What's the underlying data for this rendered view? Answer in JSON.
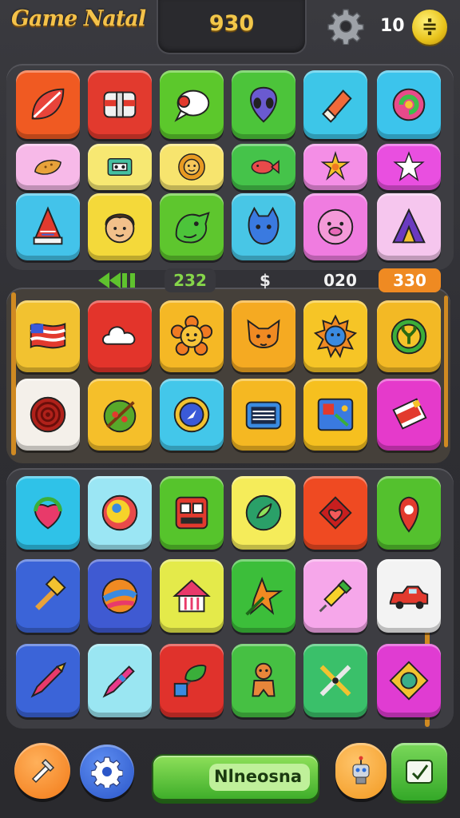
{
  "header": {
    "title": "Game Natal",
    "score": "930",
    "coins": "10",
    "coin_symbol": "≑",
    "settings_icon": "gear-icon"
  },
  "stats": {
    "item1": "232",
    "item2": "$",
    "item3": "020",
    "item4": "330"
  },
  "footer": {
    "main_button_label": "Nlneosna",
    "left_button_icon": "wrench-icon",
    "settings_button_icon": "gear-icon",
    "helper_button_icon": "robot-icon",
    "right_button_icon": "checkmark-icon"
  },
  "colors": {
    "background": "#2b2b2f",
    "accent_gold": "#f4c24a",
    "score_color": "#f2c74a",
    "stat_green": "#86d64a",
    "stat_orange": "#ef8a22"
  },
  "grids": {
    "top": [
      {
        "icon": "leaf-icon",
        "color": "#f05a22"
      },
      {
        "icon": "helmet-icon",
        "color": "#e23a2e"
      },
      {
        "icon": "chat-bubble-icon",
        "color": "#5cc82c"
      },
      {
        "icon": "alien-head-icon",
        "color": "#4cc43a"
      },
      {
        "icon": "eraser-icon",
        "color": "#3dc6e8"
      },
      {
        "icon": "swirl-icon",
        "color": "#3cc4ec"
      },
      {
        "icon": "cookie-icon",
        "color": "#f7b9e8"
      },
      {
        "icon": "cassette-icon",
        "color": "#f7e872"
      },
      {
        "icon": "lion-icon",
        "color": "#f7e46e"
      },
      {
        "icon": "fish-icon",
        "color": "#45c34a"
      },
      {
        "icon": "sun-star-icon",
        "color": "#f48ee6"
      },
      {
        "icon": "star-icon",
        "color": "#e94fe0"
      },
      {
        "icon": "rocket-icon",
        "color": "#43c3ea"
      },
      {
        "icon": "boy-face-icon",
        "color": "#f4d93a"
      },
      {
        "icon": "dragon-icon",
        "color": "#5ec62e"
      },
      {
        "icon": "cat-icon",
        "color": "#48c6e6"
      },
      {
        "icon": "pig-icon",
        "color": "#f07ce0"
      },
      {
        "icon": "tent-icon",
        "color": "#f6c6ee"
      }
    ],
    "middle": [
      {
        "icon": "flag-icon",
        "color": "#f2c230"
      },
      {
        "icon": "cloud-icon",
        "color": "#e3342b"
      },
      {
        "icon": "flower-face-icon",
        "color": "#f5b825"
      },
      {
        "icon": "fox-face-icon",
        "color": "#f5aa22"
      },
      {
        "icon": "sun-face-icon",
        "color": "#f6c526"
      },
      {
        "icon": "sprout-icon",
        "color": "#f3b925"
      },
      {
        "icon": "target-icon",
        "color": "#f4f0ea"
      },
      {
        "icon": "salad-icon",
        "color": "#f5bf2a"
      },
      {
        "icon": "compass-icon",
        "color": "#43c7ea"
      },
      {
        "icon": "radio-icon",
        "color": "#f5b822"
      },
      {
        "icon": "map-icon",
        "color": "#f6c01f"
      },
      {
        "icon": "ticket-icon",
        "color": "#e53acb"
      }
    ],
    "bottom": [
      {
        "icon": "refresh-heart-icon",
        "color": "#2fc2e8"
      },
      {
        "icon": "orb-icon",
        "color": "#9be6f4"
      },
      {
        "icon": "machine-icon",
        "color": "#56c42c"
      },
      {
        "icon": "green-orb-icon",
        "color": "#f5ec5a"
      },
      {
        "icon": "heart-icon",
        "color": "#ef4a22"
      },
      {
        "icon": "map-pin-icon",
        "color": "#54c12e"
      },
      {
        "icon": "hammer-icon",
        "color": "#3b64d8"
      },
      {
        "icon": "beach-ball-icon",
        "color": "#3f5ad2"
      },
      {
        "icon": "house-icon",
        "color": "#e4ea4a"
      },
      {
        "icon": "pencil-star-icon",
        "color": "#3cbe3a"
      },
      {
        "icon": "syringe-icon",
        "color": "#f6a7ea"
      },
      {
        "icon": "car-icon",
        "color": "#f3f3f3"
      },
      {
        "icon": "crayon-icon",
        "color": "#3b64d8"
      },
      {
        "icon": "pen-icon",
        "color": "#9ae6f2"
      },
      {
        "icon": "plant-icon",
        "color": "#e0322c"
      },
      {
        "icon": "gingerbread-icon",
        "color": "#46c043"
      },
      {
        "icon": "tools-icon",
        "color": "#3ac06a"
      },
      {
        "icon": "diamond-badge-icon",
        "color": "#e03cd2"
      }
    ]
  }
}
